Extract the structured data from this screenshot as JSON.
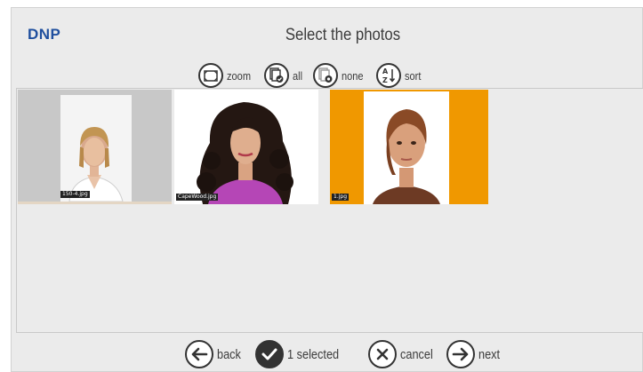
{
  "header": {
    "logo": "DNP",
    "title": "Select the photos"
  },
  "toolbar": {
    "zoom": "zoom",
    "all": "all",
    "none": "none",
    "sort": "sort"
  },
  "photos": [
    {
      "tag": "150-4.jpg",
      "selected": false,
      "background": "#c8c8c8"
    },
    {
      "tag": "CapeWood.jpg",
      "selected": false,
      "background": "#ffffff"
    },
    {
      "tag": "1.jpg",
      "selected": true,
      "background": "#f09800"
    }
  ],
  "footer": {
    "back": "back",
    "selected_count": "1 selected",
    "cancel": "cancel",
    "next": "next"
  },
  "colors": {
    "accent": "#f09800",
    "logo": "#1f4f9e",
    "icon": "#333333"
  }
}
